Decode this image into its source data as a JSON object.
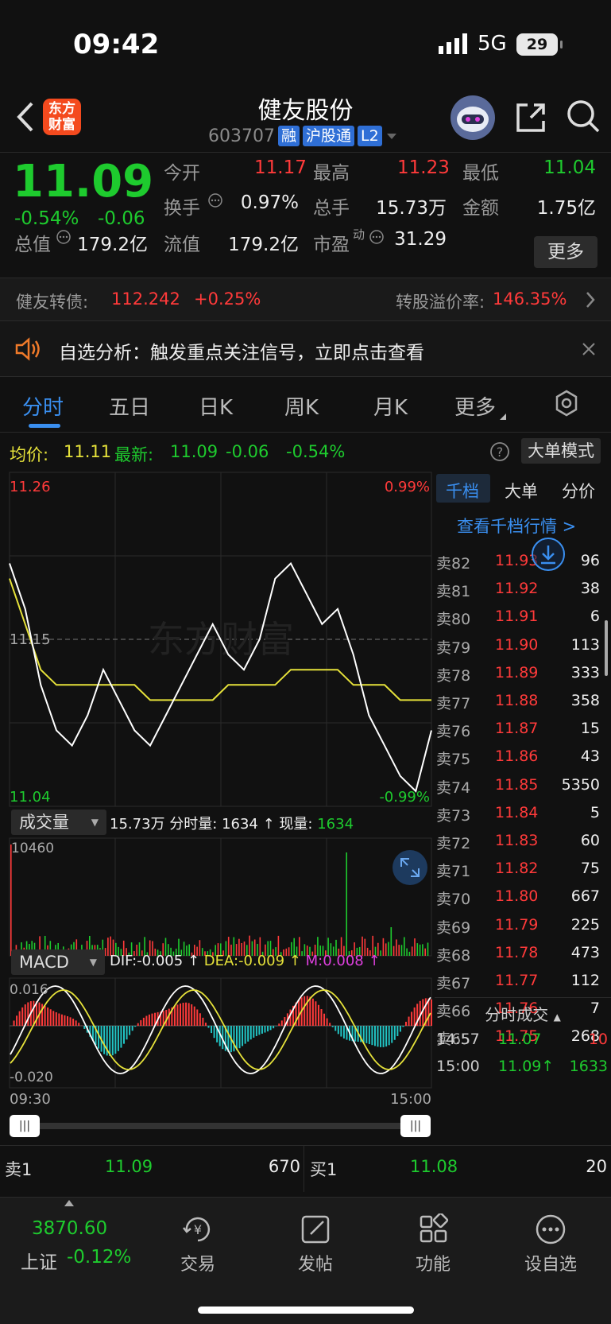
{
  "status": {
    "time": "09:42",
    "network": "5G",
    "battery": "29"
  },
  "header": {
    "logo_text": "东方财富",
    "title": "健友股份",
    "code": "603707",
    "tags": [
      "融",
      "沪股通",
      "L2"
    ]
  },
  "quote": {
    "price": "11.09",
    "pct": "-0.54%",
    "chg": "-0.06",
    "fields": [
      {
        "label": "今开",
        "value": "11.17",
        "color": "red"
      },
      {
        "label": "最高",
        "value": "11.23",
        "color": "red"
      },
      {
        "label": "最低",
        "value": "11.04",
        "color": "green"
      },
      {
        "label": "换手",
        "value": "0.97%",
        "color": "white"
      },
      {
        "label": "总手",
        "value": "15.73万",
        "color": "white"
      },
      {
        "label": "金额",
        "value": "1.75亿",
        "color": "white"
      },
      {
        "label": "总值",
        "value": "179.2亿",
        "color": "white"
      },
      {
        "label": "流值",
        "value": "179.2亿",
        "color": "white"
      },
      {
        "label": "市盈",
        "value": "31.29",
        "color": "white"
      }
    ],
    "pe_sup": "动",
    "more": "更多"
  },
  "bond": {
    "label": "健友转债:",
    "price": "112.242",
    "chg": "+0.25%",
    "premium_label": "转股溢价率:",
    "premium": "146.35%"
  },
  "banner": {
    "text": "自选分析：触发重点关注信号，立即点击查看"
  },
  "tabs": [
    "分时",
    "五日",
    "日K",
    "周K",
    "月K",
    "更多"
  ],
  "info": {
    "avg_label": "均价:",
    "avg": "11.11",
    "last_label": "最新:",
    "last": "11.09",
    "chg": "-0.06",
    "pct": "-0.54%",
    "mode": "大单模式"
  },
  "chart": {
    "high": "11.26",
    "low": "11.04",
    "mid": "11.15",
    "up_pct": "0.99%",
    "dn_pct": "-0.99%",
    "t_start": "09:30",
    "t_end": "15:00",
    "watermark": "东方财富"
  },
  "volume": {
    "label": "成交量",
    "total": "15.73万",
    "fs_label": "分时量:",
    "fs": "1634",
    "cur_label": "现量:",
    "cur": "1634",
    "max": "10460"
  },
  "macd": {
    "label": "MACD",
    "dif": "DIF:-0.005",
    "dea": "DEA:-0.009",
    "m": "M:0.008",
    "top": "0.016",
    "bottom": "-0.020"
  },
  "chart_data": {
    "type": "line",
    "x_range": [
      "09:30",
      "15:00"
    ],
    "ylim": [
      11.04,
      11.26
    ],
    "series": [
      {
        "values": [
          11.2,
          11.17,
          11.12,
          11.09,
          11.08,
          11.1,
          11.13,
          11.11,
          11.09,
          11.08,
          11.1,
          11.12,
          11.14,
          11.16,
          11.14,
          11.13,
          11.15,
          11.19,
          11.2,
          11.18,
          11.16,
          11.17,
          11.14,
          11.1,
          11.08,
          11.06,
          11.05,
          11.09
        ]
      },
      {
        "values": [
          11.19,
          11.16,
          11.13,
          11.12,
          11.12,
          11.12,
          11.12,
          11.12,
          11.12,
          11.11,
          11.11,
          11.11,
          11.11,
          11.11,
          11.12,
          11.12,
          11.12,
          11.12,
          11.13,
          11.13,
          11.13,
          11.13,
          11.12,
          11.12,
          11.12,
          11.11,
          11.11,
          11.11
        ]
      }
    ]
  },
  "book": {
    "tabs": [
      "千档",
      "大单",
      "分价"
    ],
    "link": "查看千档行情 >",
    "rows": [
      {
        "l": "卖82",
        "p": "11.93",
        "v": "96"
      },
      {
        "l": "卖81",
        "p": "11.92",
        "v": "38"
      },
      {
        "l": "卖80",
        "p": "11.91",
        "v": "6"
      },
      {
        "l": "卖79",
        "p": "11.90",
        "v": "113"
      },
      {
        "l": "卖78",
        "p": "11.89",
        "v": "333"
      },
      {
        "l": "卖77",
        "p": "11.88",
        "v": "358"
      },
      {
        "l": "卖76",
        "p": "11.87",
        "v": "15"
      },
      {
        "l": "卖75",
        "p": "11.86",
        "v": "43"
      },
      {
        "l": "卖74",
        "p": "11.85",
        "v": "5350"
      },
      {
        "l": "卖73",
        "p": "11.84",
        "v": "5"
      },
      {
        "l": "卖72",
        "p": "11.83",
        "v": "60"
      },
      {
        "l": "卖71",
        "p": "11.82",
        "v": "75"
      },
      {
        "l": "卖70",
        "p": "11.80",
        "v": "667"
      },
      {
        "l": "卖69",
        "p": "11.79",
        "v": "225"
      },
      {
        "l": "卖68",
        "p": "11.78",
        "v": "473"
      },
      {
        "l": "卖67",
        "p": "11.77",
        "v": "112"
      },
      {
        "l": "卖66",
        "p": "11.76",
        "v": "7"
      },
      {
        "l": "卖65",
        "p": "11.75",
        "v": "268"
      }
    ],
    "trades_title": "分时成交",
    "trades": [
      {
        "t": "14:57",
        "p": "11.07",
        "v": "10"
      },
      {
        "t": "15:00",
        "p": "11.09↑",
        "v": "1633"
      }
    ]
  },
  "bottom": {
    "s1_label": "卖1",
    "s1_price": "11.09",
    "s1_vol": "670",
    "b1_label": "买1",
    "b1_price": "11.08",
    "b1_vol": "20"
  },
  "dock": {
    "index_value": "3870.60",
    "index_name": "上证",
    "index_pct": "-0.12%",
    "items": [
      "交易",
      "发帖",
      "功能",
      "设自选"
    ]
  }
}
